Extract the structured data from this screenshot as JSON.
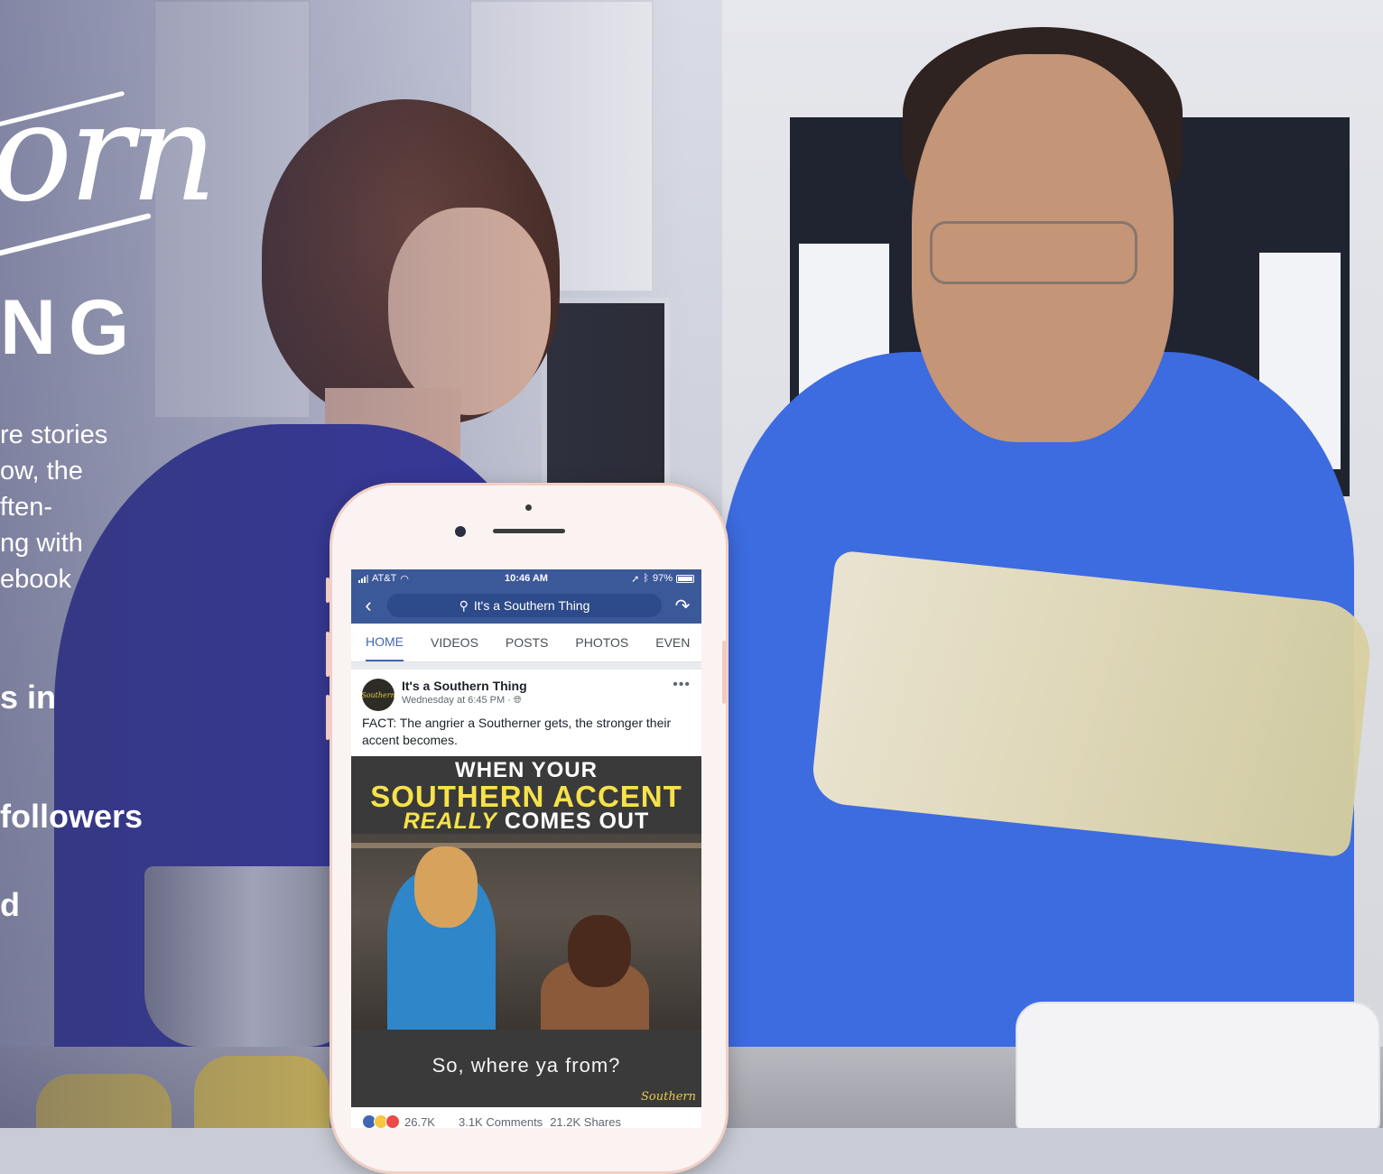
{
  "promo": {
    "script_logo": "orn",
    "brand_word": "NG",
    "paragraph": "re stories\now, the\nften-\nng with\nebook",
    "stat1": "s in",
    "stat2": " followers",
    "stat3": "d"
  },
  "phone": {
    "statusbar": {
      "carrier": "AT&T",
      "time": "10:46 AM",
      "battery": "97%"
    },
    "navbar": {
      "search_text": "It's a Southern Thing"
    },
    "tabs": [
      {
        "label": "HOME",
        "active": true
      },
      {
        "label": "VIDEOS",
        "active": false
      },
      {
        "label": "POSTS",
        "active": false
      },
      {
        "label": "PHOTOS",
        "active": false
      },
      {
        "label": "EVEN",
        "active": false
      }
    ],
    "post": {
      "page_name": "It's a Southern Thing",
      "avatar_text": "Southern",
      "timestamp": "Wednesday at 6:45 PM · ",
      "text": "FACT: The angrier a Southerner gets, the stronger their accent becomes.",
      "video": {
        "line1": "WHEN YOUR",
        "line2": "SOUTHERN ACCENT",
        "line3_em": "REALLY",
        "line3_rest": " COMES OUT",
        "caption": "So, where ya from?",
        "watermark": "Southern"
      },
      "reactions_count": "26.7K",
      "comments": "3.1K Comments",
      "shares": "21.2K Shares"
    }
  },
  "colors": {
    "facebook_blue": "#3b5998",
    "tab_active": "#4267b2",
    "headline_yellow": "#f6e24a",
    "shirt_blue": "#3d6be0"
  }
}
